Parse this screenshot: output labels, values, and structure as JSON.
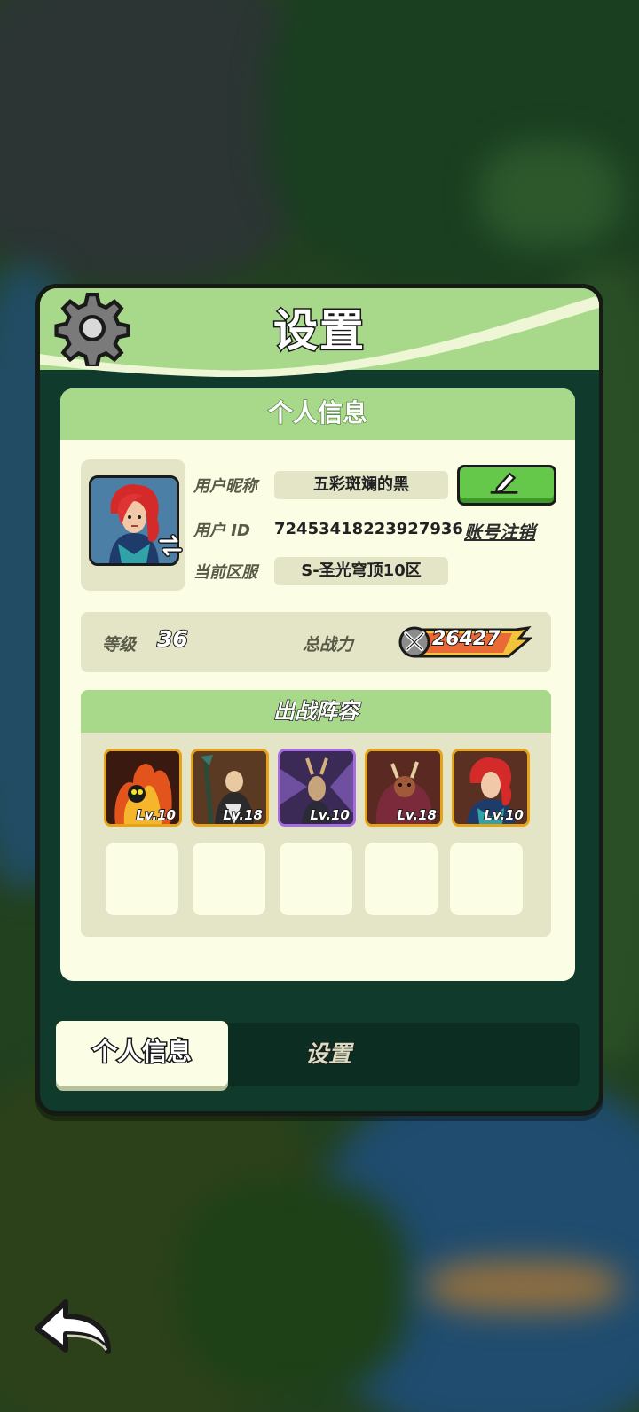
{
  "panel": {
    "title": "设置"
  },
  "profile": {
    "section_title": "个人信息",
    "nickname_label": "用户昵称",
    "nickname_value": "五彩斑斓的黑",
    "id_label": "用户 ID",
    "id_value": "72453418223927936",
    "logout_link": "账号注销",
    "server_label": "当前区服",
    "server_value": "S-圣光穹顶10区"
  },
  "stats": {
    "level_label": "等级",
    "level_value": "36",
    "power_label": "总战力",
    "power_value": "26427"
  },
  "lineup": {
    "title": "出战阵容",
    "heroes": [
      {
        "level": "Lv.10",
        "rarity": "gold"
      },
      {
        "level": "Lv.18",
        "rarity": "gold"
      },
      {
        "level": "Lv.10",
        "rarity": "purple"
      },
      {
        "level": "Lv.18",
        "rarity": "gold"
      },
      {
        "level": "Lv.10",
        "rarity": "gold"
      }
    ],
    "empty_slots": 5
  },
  "tabs": {
    "active": "个人信息",
    "inactive": "设置"
  },
  "icons": {
    "settings": "gear-icon",
    "edit": "pencil-icon",
    "swap": "swap-arrows-icon",
    "power": "crossed-swords-icon",
    "back": "back-arrow-icon"
  },
  "colors": {
    "header_green": "#a8d98a",
    "panel_dark": "#0f3a2c",
    "card_cream": "#fbfde4",
    "edit_button": "#65c84a",
    "hero_gold": "#e5a319",
    "hero_purple": "#a66ce0"
  }
}
